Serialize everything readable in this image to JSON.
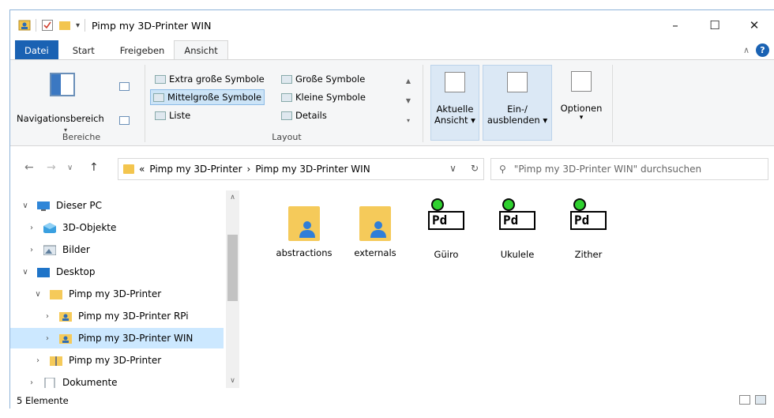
{
  "window": {
    "title": "Pimp my 3D-Printer WIN",
    "controls": {
      "minimize": "–",
      "maximize": "☐",
      "close": "✕"
    }
  },
  "ribbon_tabs": [
    "Datei",
    "Start",
    "Freigeben",
    "Ansicht"
  ],
  "ribbon": {
    "bereiche": {
      "navigationsbereich": "Navigationsbereich",
      "label": "Bereiche"
    },
    "layout": {
      "label": "Layout",
      "items": [
        "Extra große Symbole",
        "Große Symbole",
        "Mittelgroße Symbole",
        "Kleine Symbole",
        "Liste",
        "Details"
      ],
      "selected": "Mittelgroße Symbole"
    },
    "aktuelle_ansicht": {
      "line1": "Aktuelle",
      "line2": "Ansicht ▾"
    },
    "ein_ausblenden": {
      "line1": "Ein-/",
      "line2": "ausblenden ▾"
    },
    "optionen": {
      "label": "Optionen",
      "arrow": "▾"
    }
  },
  "address": {
    "prefix": "«",
    "crumbs": [
      "Pimp my 3D-Printer",
      "Pimp my 3D-Printer WIN"
    ],
    "separator": "›",
    "search_placeholder": "\"Pimp my 3D-Printer WIN\" durchsuchen"
  },
  "tree": [
    {
      "label": "Dieser PC",
      "chevron": "∨",
      "icon": "pc-icon"
    },
    {
      "label": "3D-Objekte",
      "chevron": "›",
      "icon": "cube-icon"
    },
    {
      "label": "Bilder",
      "chevron": "›",
      "icon": "pictures-icon"
    },
    {
      "label": "Desktop",
      "chevron": "∨",
      "icon": "desktop-icon"
    },
    {
      "label": "Pimp my 3D-Printer",
      "chevron": "∨",
      "icon": "folder-icon"
    },
    {
      "label": "Pimp my 3D-Printer RPi",
      "chevron": "›",
      "icon": "user-folder-icon"
    },
    {
      "label": "Pimp my 3D-Printer WIN",
      "chevron": "›",
      "icon": "user-folder-icon",
      "selected": true
    },
    {
      "label": "Pimp my 3D-Printer",
      "chevron": "›",
      "icon": "zip-folder-icon"
    },
    {
      "label": "Dokumente",
      "chevron": "›",
      "icon": "documents-icon"
    }
  ],
  "files": [
    {
      "name": "abstractions",
      "type": "folder"
    },
    {
      "name": "externals",
      "type": "folder"
    },
    {
      "name": "Güiro",
      "type": "pd"
    },
    {
      "name": "Ukulele",
      "type": "pd"
    },
    {
      "name": "Zither",
      "type": "pd"
    }
  ],
  "status": {
    "count": "5 Elemente"
  },
  "colors": {
    "accent": "#1a62b3",
    "selection": "#cce8ff",
    "folder": "#f5ca5a",
    "pd_led": "#2fd12f"
  }
}
